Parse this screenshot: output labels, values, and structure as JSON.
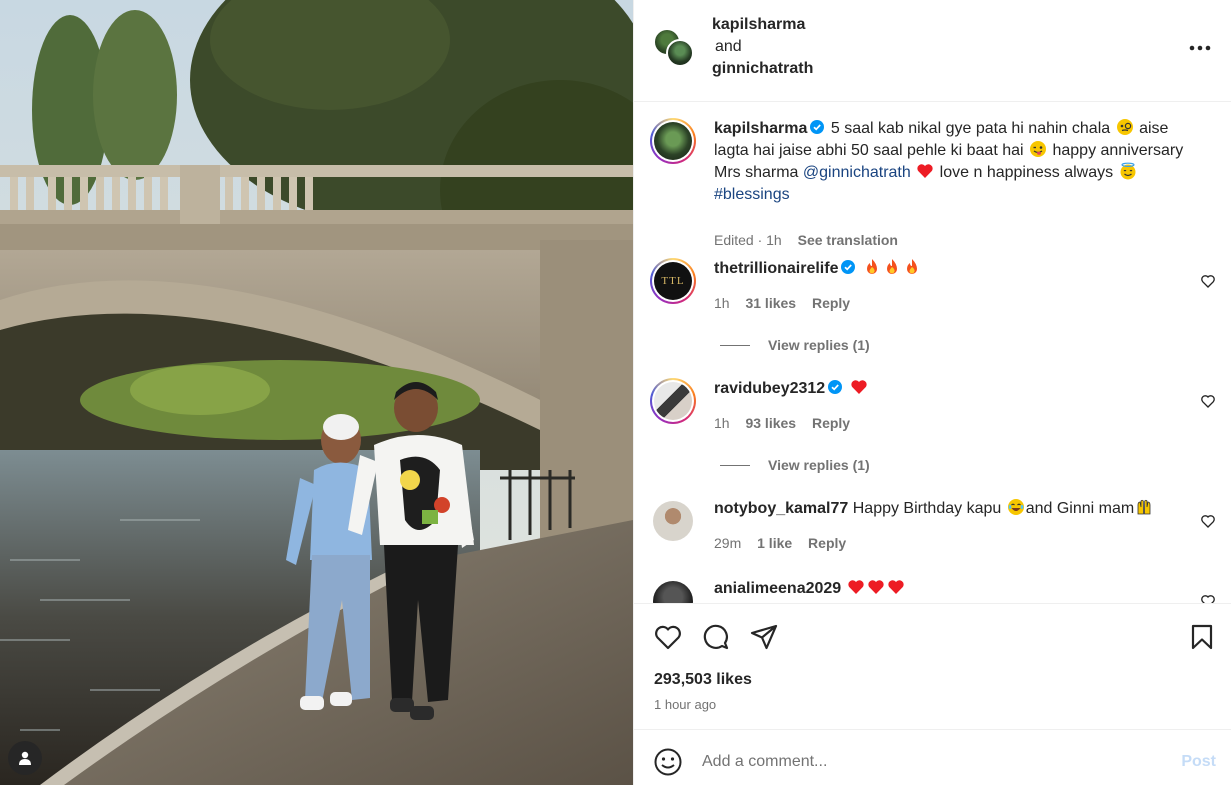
{
  "post": {
    "photo_alt": "",
    "collaborators": [
      "kapilsharma",
      "ginnichatrath"
    ],
    "and_label": "and",
    "caption": {
      "username": "kapilsharma",
      "text_1": "5 saal kab nikal gye pata hi nahin chala",
      "text_2": "aise lagta hai jaise abhi 50 saal pehle ki baat hai",
      "text_3": "happy anniversary Mrs sharma",
      "mention": "@ginnichatrath",
      "text_4": "love n happiness always",
      "hashtag": "#blessings",
      "edited": "Edited · 1h",
      "see_translation": "See translation"
    },
    "comments": [
      {
        "username": "thetrillionairelife",
        "verified": true,
        "avatar_text": "TTL",
        "time": "1h",
        "likes": "31 likes",
        "reply": "Reply",
        "view_replies": "View replies (1)"
      },
      {
        "username": "ravidubey2312",
        "verified": true,
        "time": "1h",
        "likes": "93 likes",
        "reply": "Reply",
        "view_replies": "View replies (1)"
      },
      {
        "username": "notyboy_kamal77",
        "verified": false,
        "text_1": "Happy Birthday kapu",
        "text_2": "and Ginni mam",
        "time": "29m",
        "likes": "1 like",
        "reply": "Reply"
      },
      {
        "username": "anialimeena2029",
        "verified": false
      }
    ],
    "likes": "293,503 likes",
    "time_ago": "1 hour ago",
    "add_comment_placeholder": "Add a comment...",
    "post_label": "Post"
  },
  "icons": {
    "more": "more-horizontal-icon",
    "like": "heart-icon",
    "comment": "comment-icon",
    "share": "share-icon",
    "save": "bookmark-icon",
    "emoji": "emoji-icon",
    "user_tag": "user-tag-icon",
    "verified": "verified-badge-icon"
  },
  "colors": {
    "verified": "#0095f6",
    "link": "#1a4480",
    "secondary_text": "#737373",
    "post_disabled": "#c5dcf7",
    "heart_red": "#ed1c24"
  }
}
